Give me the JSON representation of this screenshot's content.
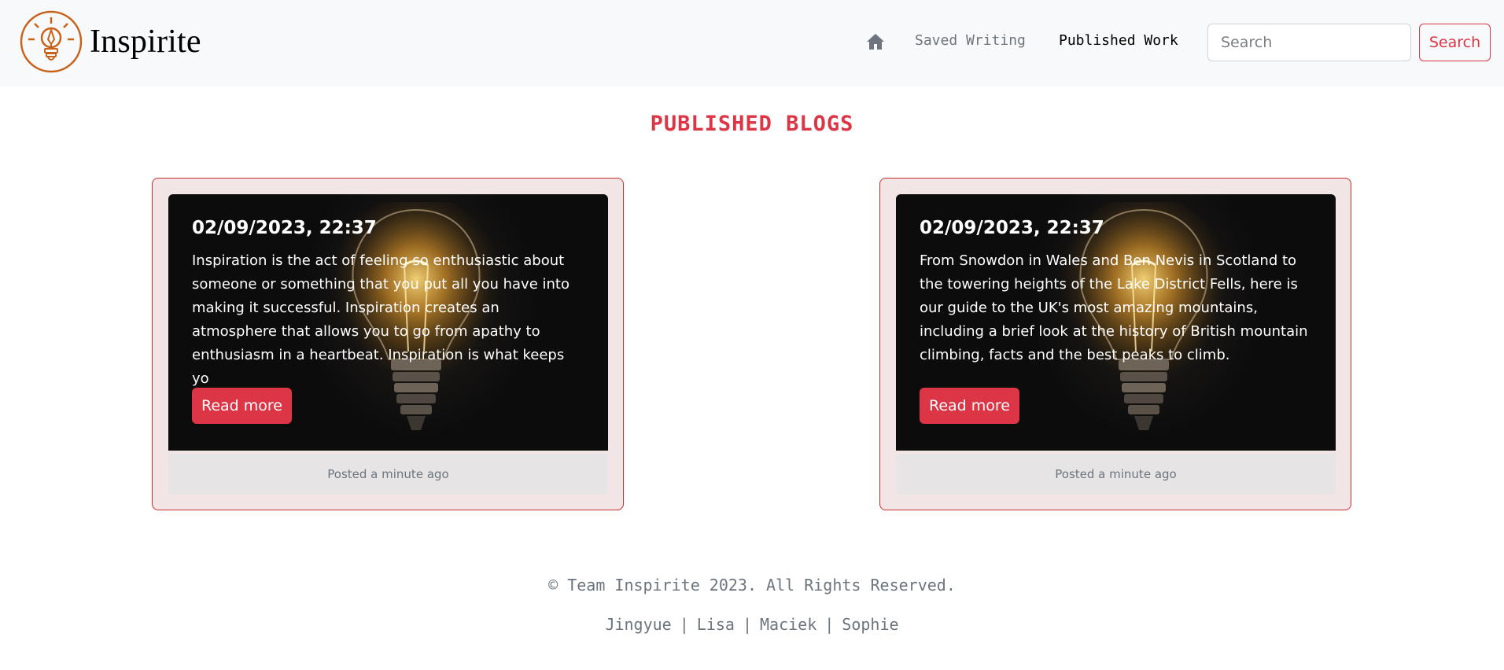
{
  "brand": {
    "name": "Inspirite"
  },
  "nav": {
    "home_icon": "home-icon",
    "saved_label": "Saved Writing",
    "published_label": "Published Work"
  },
  "search": {
    "placeholder": "Search",
    "button_label": "Search"
  },
  "page": {
    "title": "PUBLISHED BLOGS"
  },
  "colors": {
    "accent": "#dc3545",
    "navbar_bg": "#f8f9fa",
    "logo": "#c8621a"
  },
  "cards": [
    {
      "date": "02/09/2023, 22:37",
      "text": "Inspiration is the act of feeling so enthusiastic about someone or something that you put all you have into making it successful. Inspiration creates an atmosphere that allows you to go from apathy to enthusiasm in a heartbeat. Inspiration is what keeps yo",
      "button_label": "Read more",
      "posted": "Posted a minute ago"
    },
    {
      "date": "02/09/2023, 22:37",
      "text": "From Snowdon in Wales and Ben Nevis in Scotland to the towering heights of the Lake District Fells, here is our guide to the UK's most amazing mountains, including a brief look at the history of British mountain climbing, facts and the best peaks to climb.",
      "button_label": "Read more",
      "posted": "Posted a minute ago"
    }
  ],
  "footer": {
    "copyright": "© Team Inspirite 2023. All Rights Reserved.",
    "members": [
      "Jingyue",
      "Lisa",
      "Maciek",
      "Sophie"
    ],
    "separator": "|"
  }
}
